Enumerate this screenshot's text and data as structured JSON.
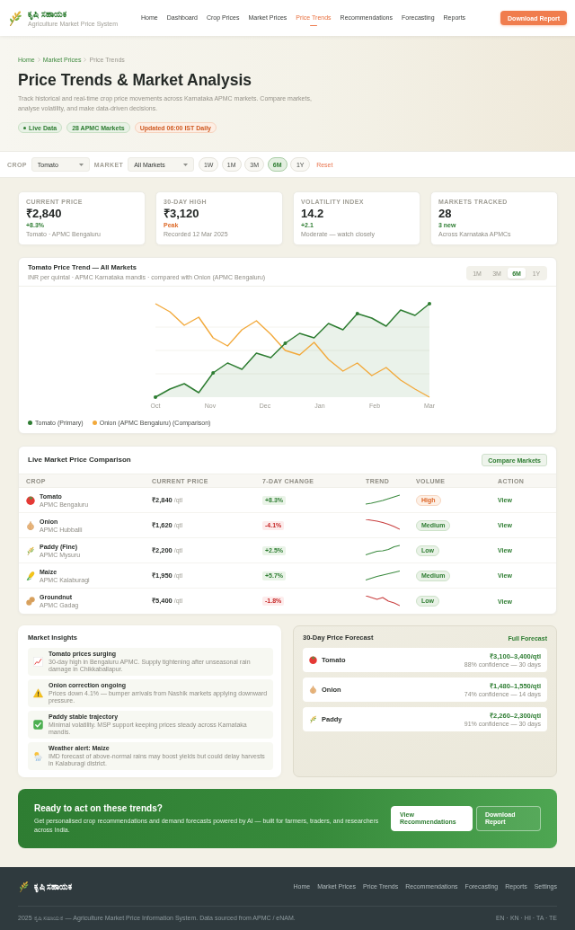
{
  "header": {
    "brand": {
      "name": "ಕೃಷಿ ಸಹಾಯಕ",
      "tagline": "Agriculture Market Price System"
    },
    "nav": [
      {
        "label": "Home",
        "selected": false
      },
      {
        "label": "Dashboard",
        "selected": false
      },
      {
        "label": "Crop Prices",
        "selected": false
      },
      {
        "label": "Market Prices",
        "selected": false
      },
      {
        "label": "Price Trends",
        "selected": true
      },
      {
        "label": "Recommendations",
        "selected": false
      },
      {
        "label": "Forecasting",
        "selected": false
      },
      {
        "label": "Reports",
        "selected": false
      }
    ],
    "action": "Download Report"
  },
  "hero": {
    "breadcrumb": [
      {
        "label": "Home",
        "current": false
      },
      {
        "label": "Market Prices",
        "current": false
      },
      {
        "label": "Price Trends",
        "current": true
      }
    ],
    "title": "Price Trends & Market Analysis",
    "description": "Track historical and real-time crop price movements across Karnataka APMC markets. Compare markets, analyse volatility, and make data-driven decisions.",
    "badges": [
      {
        "label": "Live Data",
        "kind": "live"
      },
      {
        "label": "28 APMC Markets",
        "kind": "info"
      },
      {
        "label": "Updated 06:00 IST Daily",
        "kind": "update"
      }
    ]
  },
  "filters": {
    "crop": {
      "label": "CROP",
      "value": "Tomato"
    },
    "market": {
      "label": "MARKET",
      "value": "All Markets"
    },
    "ranges": [
      {
        "label": "1W",
        "selected": false
      },
      {
        "label": "1M",
        "selected": false
      },
      {
        "label": "3M",
        "selected": false
      },
      {
        "label": "6M",
        "selected": true
      },
      {
        "label": "1Y",
        "selected": false
      }
    ],
    "reset": "Reset"
  },
  "stats": [
    {
      "label": "CURRENT PRICE",
      "value": "₹2,840",
      "delta": "+8.3%",
      "peak": false,
      "note": "Tomato · APMC Bengaluru"
    },
    {
      "label": "30-DAY HIGH",
      "value": "₹3,120",
      "delta": "Peak",
      "peak": true,
      "note": "Recorded 12 Mar 2025"
    },
    {
      "label": "VOLATILITY INDEX",
      "value": "14.2",
      "delta": "+2.1",
      "peak": false,
      "note": "Moderate — watch closely"
    },
    {
      "label": "MARKETS TRACKED",
      "value": "28",
      "delta": "3 new",
      "peak": false,
      "note": "Across Karnataka APMCs"
    }
  ],
  "trend_chart": {
    "title": "Tomato Price Trend — All Markets",
    "subtitle": "INR per quintal · APMC Karnataka mandis · compared with Onion (APMC Bengaluru)",
    "ranges": [
      {
        "label": "1M",
        "selected": false
      },
      {
        "label": "3M",
        "selected": false
      },
      {
        "label": "6M",
        "selected": true
      },
      {
        "label": "1Y",
        "selected": false
      }
    ],
    "x_labels": [
      "Oct",
      "Nov",
      "Dec",
      "Jan",
      "Feb",
      "Mar"
    ],
    "legend": [
      {
        "label": "Tomato (Primary)",
        "color": "#2e7d32"
      },
      {
        "label": "Onion (APMC Bengaluru) (Comparison)",
        "color": "#f2a93b"
      }
    ]
  },
  "comparison": {
    "title": "Live Market Price Comparison",
    "action": "Compare Markets",
    "columns": [
      "CROP",
      "CURRENT PRICE",
      "7-DAY CHANGE",
      "TREND",
      "VOLUME",
      "ACTION"
    ],
    "rows": [
      {
        "kind": "tomato",
        "crop": "Tomato",
        "market": "APMC Bengaluru",
        "price": "₹2,840",
        "unit": "/qtl",
        "change": "+8.3%",
        "rising": true,
        "volume": {
          "label": "High",
          "highlighted": true
        },
        "action": "View"
      },
      {
        "kind": "onion",
        "crop": "Onion",
        "market": "APMC Hubballi",
        "price": "₹1,620",
        "unit": "/qtl",
        "change": "-4.1%",
        "rising": false,
        "volume": {
          "label": "Medium",
          "highlighted": false
        },
        "action": "View"
      },
      {
        "kind": "paddy",
        "crop": "Paddy (Fine)",
        "market": "APMC Mysuru",
        "price": "₹2,200",
        "unit": "/qtl",
        "change": "+2.5%",
        "rising": true,
        "volume": {
          "label": "Low",
          "highlighted": false
        },
        "action": "View"
      },
      {
        "kind": "maize",
        "crop": "Maize",
        "market": "APMC Kalaburagi",
        "price": "₹1,950",
        "unit": "/qtl",
        "change": "+5.7%",
        "rising": true,
        "volume": {
          "label": "Medium",
          "highlighted": false
        },
        "action": "View"
      },
      {
        "kind": "groundnut",
        "crop": "Groundnut",
        "market": "APMC Gadag",
        "price": "₹5,400",
        "unit": "/qtl",
        "change": "-1.8%",
        "rising": false,
        "volume": {
          "label": "Low",
          "highlighted": false
        },
        "action": "View"
      }
    ]
  },
  "insights": {
    "title": "Market Insights",
    "items": [
      {
        "kind": "surge",
        "title": "Tomato prices surging",
        "text": "30-day high in Bengaluru APMC. Supply tightening after unseasonal rain damage in Chikkaballapur."
      },
      {
        "kind": "warning",
        "title": "Onion correction ongoing",
        "text": "Prices down 4.1% — bumper arrivals from Nashik markets applying downward pressure."
      },
      {
        "kind": "stable",
        "title": "Paddy stable trajectory",
        "text": "Minimal volatility. MSP support keeping prices steady across Karnataka mandis."
      },
      {
        "kind": "weather",
        "title": "Weather alert: Maize",
        "text": "IMD forecast of above-normal rains may boost yields but could delay harvests in Kalaburagi district."
      }
    ]
  },
  "forecast": {
    "title": "30-Day Price Forecast",
    "action": "Full Forecast",
    "items": [
      {
        "kind": "tomato",
        "crop": "Tomato",
        "range": "₹3,100–3,400/qtl",
        "confidence": "88% confidence — 30 days"
      },
      {
        "kind": "onion",
        "crop": "Onion",
        "range": "₹1,480–1,550/qtl",
        "confidence": "74% confidence — 14 days"
      },
      {
        "kind": "paddy",
        "crop": "Paddy",
        "range": "₹2,260–2,300/qtl",
        "confidence": "91% confidence — 30 days"
      }
    ]
  },
  "cta": {
    "title": "Ready to act on these trends?",
    "text": "Get personalised crop recommendations and demand forecasts powered by AI — built for farmers, traders, and researchers across India.",
    "buttons": [
      {
        "label": "View Recommendations",
        "kind": "primary"
      },
      {
        "label": "Download Report",
        "kind": "outline"
      }
    ]
  },
  "footer": {
    "brand": "ಕೃಷಿ ಸಹಾಯಕ",
    "links": [
      "Home",
      "Market Prices",
      "Price Trends",
      "Recommendations",
      "Forecasting",
      "Reports",
      "Settings"
    ],
    "copyright": "2025 ಕೃಷಿ ಸಹಾಯಕ — Agriculture Market Price Information System. Data sourced from APMC / eNAM.",
    "languages": "EN · KN · HI · TA · TE"
  }
}
